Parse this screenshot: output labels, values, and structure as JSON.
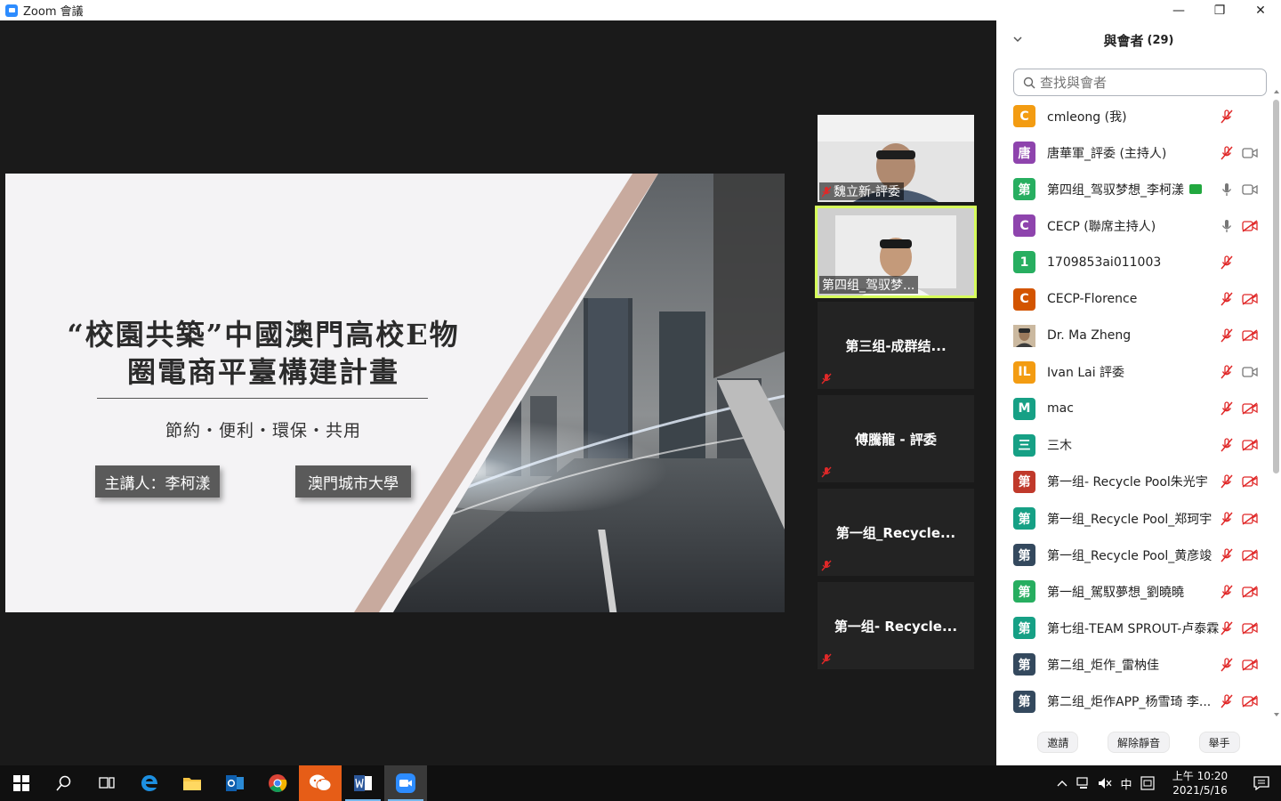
{
  "window": {
    "title": "Zoom 會議"
  },
  "slide": {
    "title_line1": "“校園共築”中國澳門高校E物",
    "title_line2": "圈電商平臺構建計畫",
    "subtitle": "節約・便利・環保・共用",
    "speaker_label": "主講人：李柯漾",
    "university": "澳門城市大學"
  },
  "tiles": [
    {
      "name": "魏立新-評委",
      "type": "video",
      "muted": true
    },
    {
      "name": "第四组_驾驭梦...",
      "type": "video",
      "active": true
    },
    {
      "name": "第三组-成群结...",
      "type": "name",
      "muted": true
    },
    {
      "name": "傅騰龍 - 評委",
      "type": "name",
      "muted": true
    },
    {
      "name": "第一组_Recycle...",
      "type": "name",
      "muted": true
    },
    {
      "name": "第一组- Recycle...",
      "type": "name",
      "muted": true
    }
  ],
  "panel": {
    "title": "與會者",
    "count": "(29)",
    "search_placeholder": "查找與會者",
    "footer": {
      "invite": "邀請",
      "unmute_all": "解除靜音",
      "raise_hand": "舉手"
    }
  },
  "participants": [
    {
      "initial": "C",
      "color": "#f39c12",
      "name": "cmleong (我)",
      "mic": "muted",
      "video": "none"
    },
    {
      "initial": "唐",
      "color": "#8e44ad",
      "name": "唐華軍_評委 (主持人)",
      "mic": "muted",
      "video": "on"
    },
    {
      "initial": "第",
      "color": "#27ae60",
      "name": "第四组_驾驭梦想_李柯漾",
      "mic": "on",
      "video": "on",
      "sharing": true
    },
    {
      "initial": "C",
      "color": "#8e44ad",
      "name": "CECP (聯席主持人)",
      "mic": "on",
      "video": "off"
    },
    {
      "initial": "1",
      "color": "#27ae60",
      "name": "1709853ai011003",
      "mic": "muted",
      "video": "none"
    },
    {
      "initial": "C",
      "color": "#d35400",
      "name": "CECP-Florence",
      "mic": "muted",
      "video": "off"
    },
    {
      "initial": "",
      "color": "#7a6a58",
      "name": "Dr. Ma Zheng",
      "mic": "muted",
      "video": "off",
      "photo": true
    },
    {
      "initial": "IL",
      "color": "#f39c12",
      "name": "Ivan Lai 評委",
      "mic": "muted",
      "video": "on"
    },
    {
      "initial": "M",
      "color": "#16a085",
      "name": "mac",
      "mic": "muted",
      "video": "off"
    },
    {
      "initial": "三",
      "color": "#16a085",
      "name": "三木",
      "mic": "muted",
      "video": "off"
    },
    {
      "initial": "第",
      "color": "#c0392b",
      "name": "第一组- Recycle Pool朱光宇",
      "mic": "muted",
      "video": "off"
    },
    {
      "initial": "第",
      "color": "#16a085",
      "name": "第一组_Recycle Pool_郑珂宇",
      "mic": "muted",
      "video": "off"
    },
    {
      "initial": "第",
      "color": "#34495e",
      "name": "第一组_Recycle Pool_黄彦竣",
      "mic": "muted",
      "video": "off"
    },
    {
      "initial": "第",
      "color": "#27ae60",
      "name": "第一組_駕馭夢想_劉曉曉",
      "mic": "muted",
      "video": "off"
    },
    {
      "initial": "第",
      "color": "#16a085",
      "name": "第七组-TEAM SPROUT-卢泰霖",
      "mic": "muted",
      "video": "off"
    },
    {
      "initial": "第",
      "color": "#34495e",
      "name": "第二组_炬作_雷枘佳",
      "mic": "muted",
      "video": "off"
    },
    {
      "initial": "第",
      "color": "#34495e",
      "name": "第二组_炬作APP_杨雪琦 李...",
      "mic": "muted",
      "video": "off"
    }
  ],
  "taskbar": {
    "time": "上午 10:20",
    "date": "2021/5/16",
    "ime": "中"
  },
  "colors": {
    "muted_red": "#e02828",
    "active_border": "#d6ff5a",
    "wechat_bg": "#e65d17"
  }
}
